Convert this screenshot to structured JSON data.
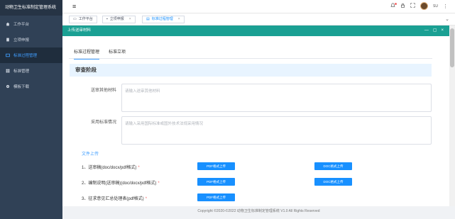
{
  "sidebar": {
    "brand": "动物卫生标准制定管理系统",
    "items": [
      {
        "label": "工作平台",
        "icon": "home-icon"
      },
      {
        "label": "立项申报",
        "icon": "doc-icon"
      },
      {
        "label": "标准过程管理",
        "icon": "list-icon",
        "active": true
      },
      {
        "label": "标准管理",
        "icon": "table-icon"
      },
      {
        "label": "模板下载",
        "icon": "gear-icon"
      }
    ]
  },
  "header": {
    "menu_icon": "≡",
    "user_name": "SU"
  },
  "tags": [
    {
      "label": "工作平台",
      "icon": "▭"
    },
    {
      "label": "立项申报",
      "icon": "▪",
      "close": "×"
    },
    {
      "label": "标准过程管理",
      "icon": "▤",
      "close": "×",
      "active": true
    }
  ],
  "dialog": {
    "title": "上传送审材料",
    "controls": [
      "—",
      "▢",
      "×"
    ],
    "tabs": [
      "标准过程管理",
      "标准立项"
    ],
    "section_title": "审查阶段",
    "fields": [
      {
        "label": "送审其他材料",
        "placeholder": "请输入送审其他材料"
      },
      {
        "label": "采用标准情况",
        "placeholder": "请输入采用国际标准或国外技术法规采用情况"
      }
    ],
    "upload_title": "文件上传",
    "files": [
      {
        "label": "1、送审稿(doc/docx/pdf格式)",
        "required": "*",
        "pdf_button": "PDF格式上传",
        "doc_button": "DOC格式上传"
      },
      {
        "label": "2、编制说明(送审稿)(doc/docx/pdf格式)",
        "required": "*",
        "pdf_button": "PDF格式上传",
        "doc_button": "DOC格式上传"
      },
      {
        "label": "3、征求意见汇总处理表(pdf格式)",
        "required": "*",
        "pdf_button": "PDF格式上传"
      }
    ]
  },
  "footer": "Copyright ©2020-©2022 动物卫生标准制定管理系统 V1.0 All Rights Reserved",
  "colors": {
    "sidebar_bg": "#304156",
    "accent": "#1890ff",
    "dialog_header": "#1aa093"
  }
}
